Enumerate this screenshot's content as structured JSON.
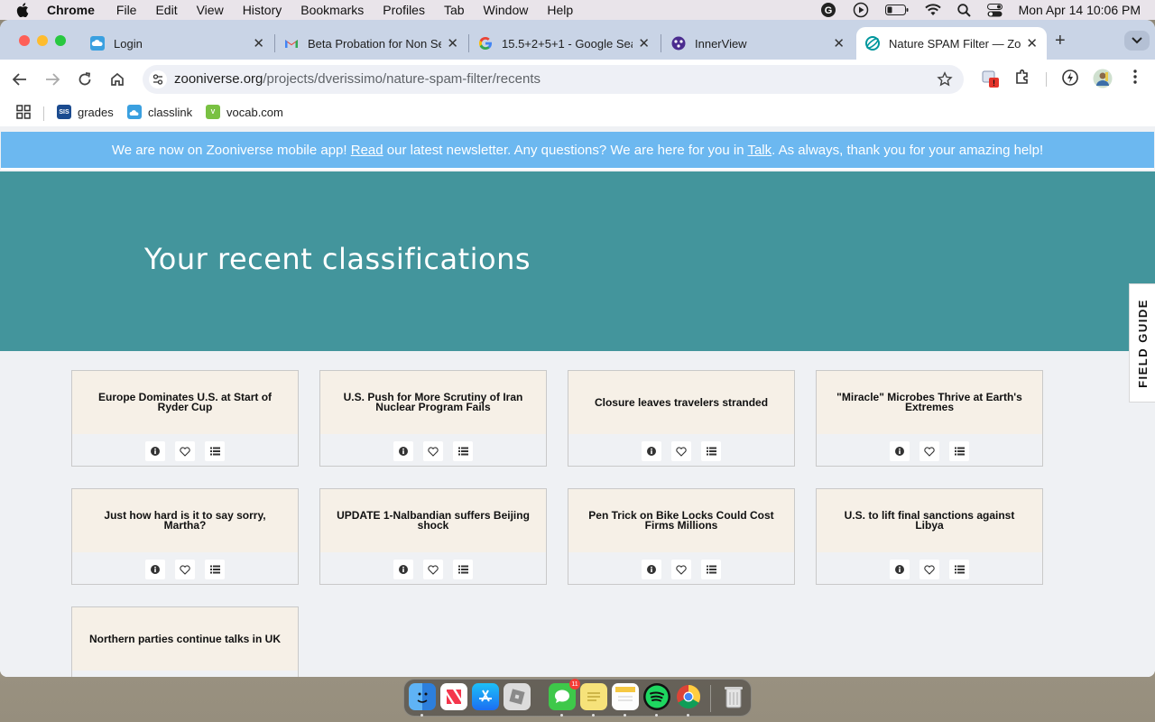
{
  "menubar": {
    "app": "Chrome",
    "items": [
      "File",
      "Edit",
      "View",
      "History",
      "Bookmarks",
      "Profiles",
      "Tab",
      "Window",
      "Help"
    ],
    "clock": "Mon Apr 14  10:06 PM"
  },
  "tabs": [
    {
      "title": "Login",
      "icon": "cloud-icon"
    },
    {
      "title": "Beta Probation for Non Se",
      "icon": "gmail-icon"
    },
    {
      "title": "15.5+2+5+1 - Google Sea",
      "icon": "google-icon"
    },
    {
      "title": "InnerView",
      "icon": "innerview-icon"
    },
    {
      "title": "Nature SPAM Filter — Zoo",
      "icon": "zooniverse-icon",
      "active": true
    }
  ],
  "address": {
    "host": "zooniverse.org",
    "path": "/projects/dverissimo/nature-spam-filter/recents"
  },
  "extension_badge": "!",
  "bookmarks": [
    {
      "label": "grades",
      "icon_text": "SIS",
      "color": "#1b4b8f"
    },
    {
      "label": "classlink",
      "icon_text": "",
      "color": "#3aa0e0"
    },
    {
      "label": "vocab.com",
      "icon_text": "V",
      "color": "#79c142"
    }
  ],
  "banner": {
    "before": "We are now on Zooniverse mobile app! ",
    "link1": "Read",
    "middle": " our latest newsletter. Any questions? We are here for you in ",
    "link2": "Talk",
    "after": ". As always, thank you for your amazing help!"
  },
  "hero": {
    "title": "Your recent classifications"
  },
  "field_guide": "FIELD GUIDE",
  "cards": [
    {
      "title": "Europe Dominates U.S. at Start of Ryder Cup"
    },
    {
      "title": "U.S. Push for More Scrutiny of Iran Nuclear Program Fails"
    },
    {
      "title": "Closure leaves travelers stranded"
    },
    {
      "title": "\"Miracle\" Microbes Thrive at Earth's Extremes"
    },
    {
      "title": "Just how hard is it to say sorry, Martha?"
    },
    {
      "title": "UPDATE 1-Nalbandian suffers Beijing shock"
    },
    {
      "title": "Pen Trick on Bike Locks Could Cost Firms Millions"
    },
    {
      "title": "U.S. to lift final sanctions against Libya"
    },
    {
      "title": "Northern parties continue talks in UK"
    }
  ],
  "dock": {
    "apps": [
      "finder-icon",
      "news-icon",
      "app-store-icon",
      "roblox-icon",
      "messages-icon",
      "stickies-icon",
      "notes-icon",
      "spotify-icon",
      "chrome-icon",
      "trash-icon"
    ],
    "messages_badge": "11"
  },
  "colors": {
    "hero": "#43959c",
    "banner": "#6cb8f0",
    "card_title_bg": "#f6f0e7",
    "page_bg": "#eff1f4"
  }
}
